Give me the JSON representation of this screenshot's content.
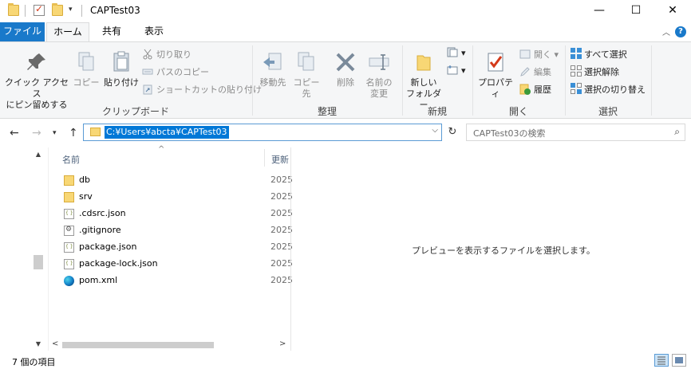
{
  "window": {
    "title": "CAPTest03",
    "minimize": "—",
    "maximize": "☐",
    "close": "✕"
  },
  "ribbon_tabs": {
    "file": "ファイル",
    "home": "ホーム",
    "share": "共有",
    "view": "表示"
  },
  "clipboard": {
    "pin": "クイック アクセス\nにピン留めする",
    "pin_l1": "クイック アクセス",
    "pin_l2": "にピン留めする",
    "copy": "コピー",
    "paste": "貼り付け",
    "cut": "切り取り",
    "copy_path": "パスのコピー",
    "paste_shortcut": "ショートカットの貼り付け",
    "group": "クリップボード"
  },
  "organize": {
    "move_to": "移動先",
    "copy_to": "コピー先",
    "delete": "削除",
    "rename_l1": "名前の",
    "rename_l2": "変更",
    "group": "整理"
  },
  "new": {
    "new_folder_l1": "新しい",
    "new_folder_l2": "フォルダー",
    "group": "新規"
  },
  "open": {
    "properties": "プロパティ",
    "open": "開く",
    "edit": "編集",
    "history": "履歴",
    "group": "開く"
  },
  "select": {
    "select_all": "すべて選択",
    "select_none": "選択解除",
    "invert": "選択の切り替え",
    "group": "選択"
  },
  "address": {
    "path": "C:¥Users¥abcta¥CAPTest03",
    "search_placeholder": "CAPTest03の検索"
  },
  "columns": {
    "name": "名前",
    "date": "更新"
  },
  "files": [
    {
      "name": "db",
      "type": "folder",
      "date": "2025"
    },
    {
      "name": "srv",
      "type": "folder",
      "date": "2025"
    },
    {
      "name": ".cdsrc.json",
      "type": "json",
      "date": "2025"
    },
    {
      "name": ".gitignore",
      "type": "git",
      "date": "2025"
    },
    {
      "name": "package.json",
      "type": "json",
      "date": "2025"
    },
    {
      "name": "package-lock.json",
      "type": "json",
      "date": "2025"
    },
    {
      "name": "pom.xml",
      "type": "edge",
      "date": "2025"
    }
  ],
  "preview": {
    "message": "プレビューを表示するファイルを選択します。"
  },
  "status": {
    "count": "7 個の項目"
  }
}
